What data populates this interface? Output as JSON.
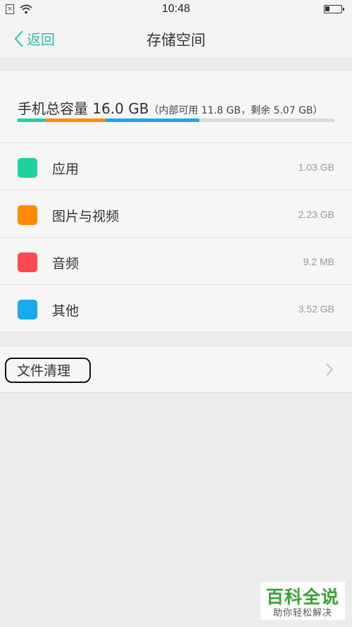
{
  "status_bar": {
    "time": "10:48",
    "sim_icon": "sim-x-icon",
    "wifi_icon": "wifi-icon",
    "battery_icon": "battery-low-icon"
  },
  "nav": {
    "back_label": "返回",
    "title": "存储空间",
    "accent_color": "#2ebfa5"
  },
  "storage": {
    "total_label": "手机总容量 16.0 GB",
    "detail_label": "（内部可用 11.8 GB，剩余 5.07 GB）",
    "usage_segments": [
      {
        "color": "#1dd1a1",
        "fraction": 0.086
      },
      {
        "color": "#ff8c00",
        "fraction": 0.191
      },
      {
        "color": "#1aa9f0",
        "fraction": 0.297
      },
      {
        "color": "#d9d9d9",
        "fraction": 0.426
      }
    ]
  },
  "categories": [
    {
      "label": "应用",
      "size": "1.03 GB",
      "color": "#1dd1a1"
    },
    {
      "label": "图片与视频",
      "size": "2.23 GB",
      "color": "#ff8c00"
    },
    {
      "label": "音频",
      "size": "9.2 MB",
      "color": "#ff4a55"
    },
    {
      "label": "其他",
      "size": "3.52 GB",
      "color": "#1aa9f0"
    }
  ],
  "cleanup": {
    "label": "文件清理"
  },
  "watermark": {
    "title": "百科全说",
    "subtitle": "助你轻松解决"
  }
}
